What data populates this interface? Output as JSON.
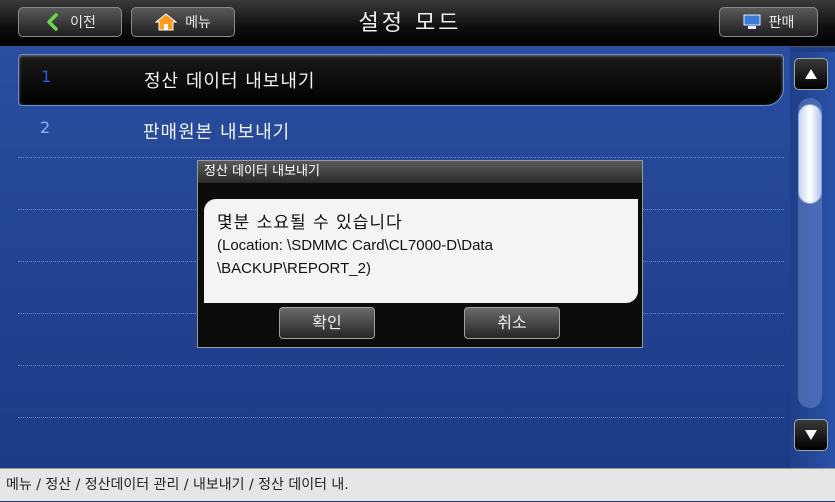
{
  "header": {
    "back_label": "이전",
    "menu_label": "메뉴",
    "title": "설정 모드",
    "sales_label": "판매"
  },
  "list": {
    "items": [
      {
        "number": "1",
        "label": "정산 데이터 내보내기",
        "selected": true
      },
      {
        "number": "2",
        "label": "판매원본 내보내기",
        "selected": false
      }
    ]
  },
  "dialog": {
    "title": "정산 데이터 내보내기",
    "message_line1": "몇분 소요될 수 있습니다",
    "message_line2": "(Location: \\SDMMC Card\\CL7000-D\\Data",
    "message_line3": "\\BACKUP\\REPORT_2)",
    "ok_label": "확인",
    "cancel_label": "취소"
  },
  "breadcrumb": "메뉴 / 정산 / 정산데이터 관리 / 내보내기 / 정산 데이터 내.",
  "colors": {
    "accent": "#2d57d8",
    "background": "#1d3d86",
    "back_arrow": "#6cd84a",
    "home_icon": "#ff9a1a"
  },
  "icons": [
    "back-arrow-icon",
    "home-icon",
    "computer-icon",
    "scroll-up-arrow-icon",
    "scroll-down-arrow-icon"
  ]
}
